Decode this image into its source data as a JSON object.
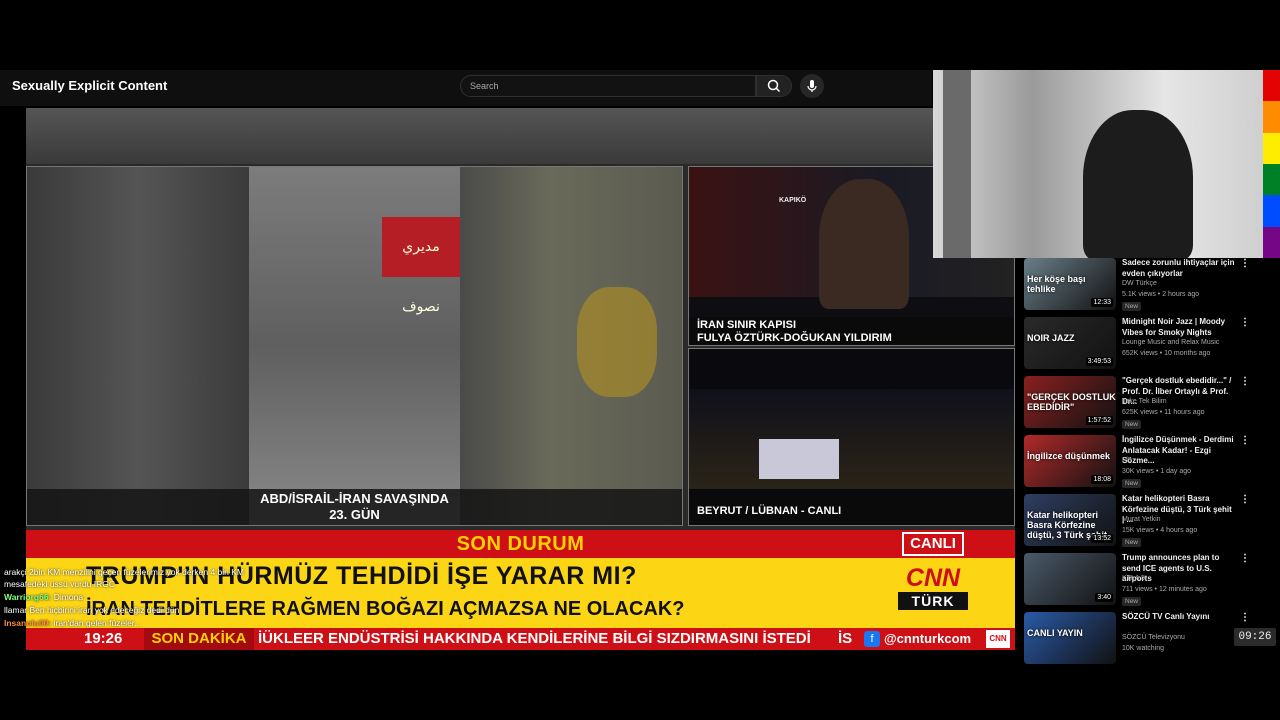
{
  "page": {
    "title": "Sexually Explicit Content",
    "search_placeholder": "Search"
  },
  "video": {
    "main_caption_line1": "ABD/İSRAİL-İRAN SAVAŞINDA",
    "main_caption_line2": "23. GÜN",
    "main_sign_text": "ﻣﺪﻳﺮﻱ ﻧﺼﻮﻑ",
    "top_right_caption_line1": "İRAN SINIR KAPISI",
    "top_right_caption_line2": "FULYA ÖZTÜRK-DOĞUKAN YILDIRIM",
    "top_right_building_label": "KAPIKÖ",
    "bottom_right_caption": "BEYRUT / LÜBNAN - CANLI",
    "son_durum": "SON DURUM",
    "canli": "CANLI",
    "headline1": "TRUMP'IN HÜRMÜZ TEHDİDİ İŞE YARAR MI?",
    "headline2": "İRAN TEHDİTLERE RAĞMEN BOĞAZI AÇMAZSA NE OLACAK?",
    "cnn_logo_top": "CNN",
    "cnn_logo_bottom": "TÜRK",
    "ticker_time": "19:26",
    "son_dakika": "SON DAKİKA",
    "crawl": "İÜKLEER ENDÜSTRİSİ HAKKINDA KENDİLERİNE BİLGİ SIZDIRMASINI İSTEDİ",
    "crawl_letters": "İS",
    "handle": "@cnnturkcom",
    "handle_icon": "f",
    "mini_logo": "CNN"
  },
  "chat": [
    {
      "user": "",
      "text": "arakçi 2bin KM menzilini geçen füzelerimiz yok derken 4 bin KM mesafedeki üssü vurdu IRGC"
    },
    {
      "user": "Warriorg66:",
      "text": "Dimona"
    },
    {
      "user": "",
      "text": "llamar Ben hiçbirini iran yok edeceğiz dedi dün"
    },
    {
      "user": "Insanolu00:",
      "text": "iran'dan gelen füzeler..."
    }
  ],
  "recommendations": [
    {
      "title": "Sadece zorunlu ihtiyaçlar için evden çıkıyorlar",
      "channel": "DW Türkçe",
      "meta": "5.1K views • 2 hours ago",
      "badge": "New",
      "duration": "12:33",
      "overlay": "Her köşe başı tehlike",
      "thumb_color": "#6a7f8a"
    },
    {
      "title": "Midnight Noir Jazz | Moody Vibes for Smoky Nights",
      "channel": "Lounge Music and Relax Music",
      "meta": "652K views • 10 months ago",
      "badge": "",
      "duration": "3:49:53",
      "overlay": "NOIR JAZZ",
      "thumb_color": "#2a2a2a"
    },
    {
      "title": "\"Gerçek dostluk ebedidir...\" / Prof. Dr. İlber Ortaylı & Prof. Dr...",
      "channel": "Teke Tek Bilim",
      "meta": "625K views • 11 hours ago",
      "badge": "New",
      "duration": "1:57:52",
      "overlay": "\"GERÇEK DOSTLUK EBEDİDİR\"",
      "thumb_color": "#8a2020"
    },
    {
      "title": "İngilizce Düşünmek - Derdimi Anlatacak Kadar! - Ezgi Sözme...",
      "channel": "Flu",
      "meta": "30K views • 1 day ago",
      "badge": "New",
      "duration": "18:08",
      "overlay": "İngilizce düşünmek",
      "thumb_color": "#b02a2a"
    },
    {
      "title": "Katar helikopteri Basra Körfezine düştü, 3 Türk şehit | ...",
      "channel": "Murat Yetkin",
      "meta": "15K views • 4 hours ago",
      "badge": "New",
      "duration": "13:52",
      "overlay": "Katar helikopteri Basra Körfezine düştü, 3 Türk şehit",
      "thumb_color": "#2f3f62"
    },
    {
      "title": "Trump announces plan to send ICE agents to U.S. airports",
      "channel": "KTLA 5",
      "meta": "711 views • 12 minutes ago",
      "badge": "New",
      "duration": "3:40",
      "overlay": "",
      "thumb_color": "#4a5a6a"
    },
    {
      "title": "SÖZCÜ TV Canlı Yayını",
      "channel": "SÖZCÜ Televizyonu",
      "meta": "10K watching",
      "badge": "",
      "duration": "",
      "overlay": "CANLI YAYIN",
      "thumb_color": "#2a5aa8"
    }
  ],
  "yt_clock": "09:26",
  "colors": {
    "cnn_red": "#cf0f16",
    "headline_yellow": "#fcd615",
    "rainbow": [
      "#e40303",
      "#ff8c00",
      "#ffed00",
      "#008026",
      "#004dff",
      "#750787"
    ]
  }
}
